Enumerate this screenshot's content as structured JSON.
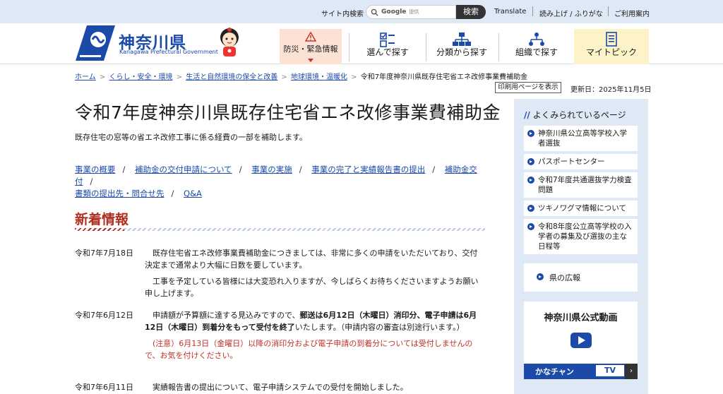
{
  "utility": {
    "site_search_label": "サイト内検索",
    "search_placeholder": "Google 提供",
    "search_brand": "Google",
    "search_sub": "提供",
    "search_button": "検索",
    "translate": "Translate",
    "read_aloud": "読み上げ / ふりがな",
    "guide": "ご利用案内"
  },
  "header": {
    "logo_title": "神奈川県",
    "logo_sub": "Kanagawa Prefectural Government",
    "nav": [
      {
        "label": "防災・緊急情報",
        "icon": "warning-icon"
      },
      {
        "label": "選んで探す",
        "icon": "select-icon"
      },
      {
        "label": "分類から探す",
        "icon": "category-icon"
      },
      {
        "label": "組織で探す",
        "icon": "organization-icon"
      },
      {
        "label": "マイトピック",
        "icon": "mytopic-icon"
      }
    ]
  },
  "breadcrumb": [
    "ホーム",
    "くらし・安全・環境",
    "生活と自然環境の保全と改善",
    "地球環境・温暖化",
    "令和7年度神奈川県既存住宅省エネ改修事業費補助金"
  ],
  "page": {
    "print_label": "印刷用ページを表示",
    "updated": "更新日：2025年11月5日",
    "title": "令和7年度神奈川県既存住宅省エネ改修事業費補助金",
    "lead": "既存住宅の窓等の省エネ改修工事に係る経費の一部を補助します。",
    "anchors": [
      "事業の概要",
      "補助金の交付申請について",
      "事業の実施",
      "事業の完了と実績報告書の提出",
      "補助金交付",
      "書類の提出先・問合せ先",
      "Q&A"
    ]
  },
  "news": {
    "heading": "新着情報",
    "items": [
      {
        "date": "令和7年7月18日",
        "p1": "既存住宅省エネ改修事業費補助金につきましては、非常に多くの申請をいただいており、交付決定まで通常より大幅に日数を要しています。",
        "p2": "工事を予定している皆様には大変恐れ入りますが、今しばらくお待ちくださいますようお願い申し上げます。"
      },
      {
        "date": "令和7年6月12日",
        "p1_a": "申請額が予算額に達する見込みですので、",
        "p1_b": "郵送は6月12日（木曜日）消印分、電子申請は6月12日（木曜日）到着分をもって受付を終了",
        "p1_c": "いたします。（申請内容の審査は別途行います。）",
        "p2": "(注意）6月13日（金曜日）以降の消印分および電子申請の到着分については受付しませんので、お気を付けください。"
      },
      {
        "date": "令和7年6月11日",
        "p1": "実績報告書の提出について、電子申請システムでの受付を開始しました。"
      }
    ]
  },
  "sidebar": {
    "heading": "よくみられているページ",
    "items": [
      "神奈川県公立高等学校入学者選抜",
      "パスポートセンター",
      "令和7年度共通選抜学力検査問題",
      "ツキノワグマ情報について",
      "令和8年度公立高等学校の入学者の募集及び選抜の主な日程等"
    ],
    "kohou": "県の広報",
    "video_title": "神奈川県公式動画",
    "tv_label": "かなチャン",
    "tv_mark": "TV"
  },
  "colors": {
    "accent": "#1b4aa8",
    "news_red": "#b03020",
    "sidebar_bg": "#dfe8f5"
  }
}
